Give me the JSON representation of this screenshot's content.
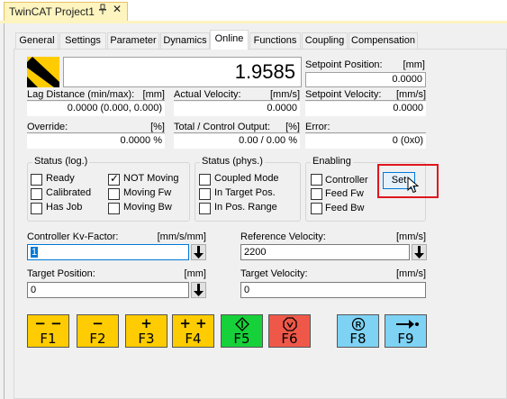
{
  "window": {
    "title": "TwinCAT Project1",
    "pin_icon": "pin-icon",
    "close_glyph": "✕"
  },
  "tabs": [
    {
      "label": "General",
      "active": false
    },
    {
      "label": "Settings",
      "active": false
    },
    {
      "label": "Parameter",
      "active": false
    },
    {
      "label": "Dynamics",
      "active": false
    },
    {
      "label": "Online",
      "active": true
    },
    {
      "label": "Functions",
      "active": false
    },
    {
      "label": "Coupling",
      "active": false
    },
    {
      "label": "Compensation",
      "active": false
    }
  ],
  "online": {
    "position_value": "1.9585",
    "setpoint_position": {
      "label": "Setpoint Position:",
      "unit": "[mm]",
      "value": "0.0000"
    },
    "lag_distance": {
      "label": "Lag Distance (min/max):",
      "unit": "[mm]",
      "value": "0.0000  (0.000, 0.000)"
    },
    "actual_velocity": {
      "label": "Actual Velocity:",
      "unit": "[mm/s]",
      "value": "0.0000"
    },
    "setpoint_velocity": {
      "label": "Setpoint Velocity:",
      "unit": "[mm/s]",
      "value": "0.0000"
    },
    "override": {
      "label": "Override:",
      "unit": "[%]",
      "value": "0.0000 %"
    },
    "total_control_output": {
      "label": "Total / Control Output:",
      "unit": "[%]",
      "value": "0.00 /  0.00 %"
    },
    "error": {
      "label": "Error:",
      "value": "0 (0x0)"
    }
  },
  "status_log": {
    "title": "Status (log.)",
    "items": [
      {
        "label": "Ready",
        "checked": false
      },
      {
        "label": "Calibrated",
        "checked": false
      },
      {
        "label": "Has Job",
        "checked": false
      },
      {
        "label": "NOT Moving",
        "checked": true
      },
      {
        "label": "Moving Fw",
        "checked": false
      },
      {
        "label": "Moving Bw",
        "checked": false
      }
    ]
  },
  "status_phys": {
    "title": "Status (phys.)",
    "items": [
      {
        "label": "Coupled Mode",
        "checked": false
      },
      {
        "label": "In Target Pos.",
        "checked": false
      },
      {
        "label": "In Pos. Range",
        "checked": false
      }
    ]
  },
  "enabling": {
    "title": "Enabling",
    "items": [
      {
        "label": "Controller",
        "checked": false
      },
      {
        "label": "Feed Fw",
        "checked": false
      },
      {
        "label": "Feed Bw",
        "checked": false
      }
    ],
    "set_label": "Set",
    "highlight_color": "#e0161e"
  },
  "inputs": {
    "kv_factor": {
      "label": "Controller Kv-Factor:",
      "unit": "[mm/s/mm]",
      "value": "1"
    },
    "reference_velocity": {
      "label": "Reference Velocity:",
      "unit": "[mm/s]",
      "value": "2200"
    },
    "target_position": {
      "label": "Target Position:",
      "unit": "[mm]",
      "value": "0"
    },
    "target_velocity": {
      "label": "Target Velocity:",
      "unit": "[mm/s]",
      "value": "0"
    }
  },
  "function_buttons": [
    {
      "key": "F1",
      "glyph": "− −",
      "icon": "double-minus-icon",
      "color": "#fecc00"
    },
    {
      "key": "F2",
      "glyph": "−",
      "icon": "minus-icon",
      "color": "#fecc00"
    },
    {
      "key": "F3",
      "glyph": "+",
      "icon": "plus-icon",
      "color": "#fecc00"
    },
    {
      "key": "F4",
      "glyph": "+ +",
      "icon": "double-plus-icon",
      "color": "#fecc00"
    },
    {
      "key": "F5",
      "glyph": "",
      "icon": "enable-icon",
      "color": "#17d13a"
    },
    {
      "key": "F6",
      "glyph": "",
      "icon": "stop-icon",
      "color": "#ef5849"
    },
    {
      "key": "F8",
      "glyph": "",
      "icon": "reset-icon",
      "color": "#7ed3f5"
    },
    {
      "key": "F9",
      "glyph": "",
      "icon": "reference-icon",
      "color": "#7ed3f5"
    }
  ]
}
